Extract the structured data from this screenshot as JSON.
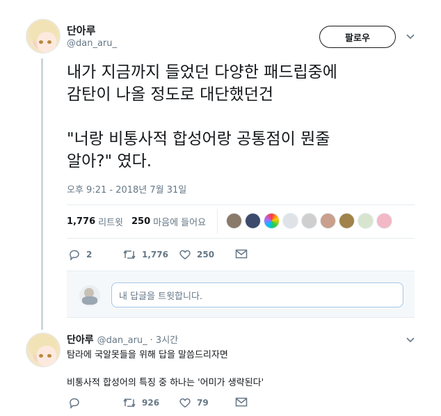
{
  "tweet": {
    "author_name": "단아루",
    "author_handle": "@dan_aru_",
    "follow_label": "팔로우",
    "text": "내가 지금까지 들었던 다양한 패드립중에\n감탄이 나올 정도로 대단했던건\n\n\"너랑 비통사적 합성어랑 공통점이 뭔줄\n알아?\" 였다.",
    "timestamp": "오후 9:21 - 2018년 7월 31일",
    "retweet_count": "1,776",
    "retweet_label": "리트윗",
    "like_count": "250",
    "like_label": "마음에 들어요",
    "actions": {
      "reply": "2",
      "retweet": "1,776",
      "like": "250"
    }
  },
  "reply_box": {
    "placeholder": "내 답글을 트윗합니다."
  },
  "reply_tweet": {
    "author_name": "단아루",
    "author_handle": "@dan_aru_",
    "age": "· 3시간",
    "text": "탐라에 국알못들을 위해 답을 말씀드리자면\n\n비통사적 합성어의 특징 중 하나는 '어미가 생략된다'",
    "actions": {
      "reply": "",
      "retweet": "926",
      "like": "79"
    }
  },
  "icons": {
    "chevron": "chevron-down-icon",
    "reply": "reply-icon",
    "retweet": "retweet-icon",
    "like": "heart-icon",
    "dm": "envelope-icon"
  },
  "colors": {
    "text": "#14171a",
    "secondary": "#657786",
    "border": "#e6ecf0",
    "input_border": "#a3c6ea"
  },
  "liker_colors": [
    "#8a7a6a",
    "#3c4a6b",
    "#ff6bd6",
    "#dfe3e8",
    "#cfcfcf",
    "#c9a08e",
    "#a0824a",
    "#d7e5cf",
    "#f2b8c6"
  ]
}
